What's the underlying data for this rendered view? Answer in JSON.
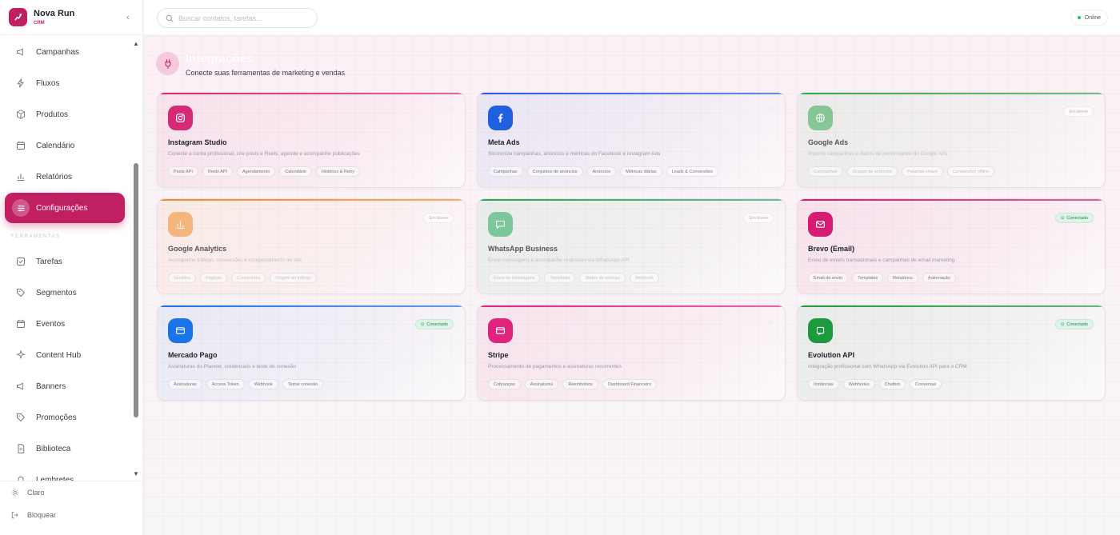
{
  "brand": {
    "name": "Nova Run",
    "sub": "CRM"
  },
  "sidebar": {
    "items": [
      {
        "label": "Campanhas",
        "icon": "megaphone-icon"
      },
      {
        "label": "Fluxos",
        "icon": "zap-icon"
      },
      {
        "label": "Produtos",
        "icon": "box-icon"
      },
      {
        "label": "Calendário",
        "icon": "calendar-icon"
      },
      {
        "label": "Relatórios",
        "icon": "bar-chart-icon"
      },
      {
        "label": "Configurações",
        "icon": "sliders-icon",
        "active": true
      }
    ],
    "section_label": "FERRAMENTAS",
    "tools": [
      {
        "label": "Tarefas",
        "icon": "checkbox-icon"
      },
      {
        "label": "Segmentos",
        "icon": "tag-icon"
      },
      {
        "label": "Eventos",
        "icon": "calendar-icon"
      },
      {
        "label": "Content Hub",
        "icon": "sparkle-icon"
      },
      {
        "label": "Banners",
        "icon": "megaphone-icon"
      },
      {
        "label": "Promoções",
        "icon": "tag-icon"
      },
      {
        "label": "Biblioteca",
        "icon": "file-icon"
      },
      {
        "label": "Lembretes",
        "icon": "bell-icon"
      }
    ],
    "bottom": {
      "theme": "Claro",
      "lock": "Bloquear"
    }
  },
  "topbar": {
    "search_placeholder": "Buscar contatos, tarefas...",
    "status": "Online"
  },
  "page": {
    "title": "Integrações",
    "subtitle": "Conecte suas ferramentas de marketing e vendas"
  },
  "cards": [
    {
      "title": "Instagram Studio",
      "desc": "Conecte a conta profissional, crie posts e Reels, agende e acompanhe publicações",
      "tags": [
        "Posts API",
        "Reels API",
        "Agendamento",
        "Calendário",
        "Histórico & Retry"
      ],
      "color": "#d62976",
      "icon": "instagram-icon",
      "status": "",
      "starred": true
    },
    {
      "title": "Meta Ads",
      "desc": "Sincronize campanhas, anúncios e métricas do Facebook e Instagram Ads",
      "tags": [
        "Campanhas",
        "Conjuntos de anúncios",
        "Anúncios",
        "Métricas diárias",
        "Leads & Conversões"
      ],
      "color": "#1f5fe0",
      "icon": "facebook-icon",
      "status": "",
      "starred": true
    },
    {
      "title": "Google Ads",
      "desc": "Importe campanhas e dados de performance do Google Ads",
      "tags": [
        "Campanhas",
        "Grupos de anúncios",
        "Palavras-chave",
        "Conversões offline"
      ],
      "color": "#34a853",
      "icon": "globe-icon",
      "status": "Em breve",
      "starred": false
    },
    {
      "title": "Google Analytics",
      "desc": "Acompanhe tráfego, conversões e comportamento no site",
      "tags": [
        "Sessões",
        "Páginas",
        "Conversões",
        "Origem do tráfego"
      ],
      "color": "#f28c28",
      "icon": "bar-chart-icon",
      "status": "Em breve",
      "starred": false
    },
    {
      "title": "WhatsApp Business",
      "desc": "Envie mensagens e acompanhe respostas via WhatsApp API",
      "tags": [
        "Envio de mensagens",
        "Templates",
        "Status de entrega",
        "Webhook"
      ],
      "color": "#22a85a",
      "icon": "chat-icon",
      "status": "Em breve",
      "starred": false
    },
    {
      "title": "Brevo (Email)",
      "desc": "Envio de emails transacionais e campanhas de email marketing",
      "tags": [
        "Email de envio",
        "Templates",
        "Relatórios",
        "Automação"
      ],
      "color": "#d81b72",
      "icon": "mail-icon",
      "status": "Conectado",
      "starred": false
    },
    {
      "title": "Mercado Pago",
      "desc": "Assinaturas do Planner, credenciais e teste de conexão",
      "tags": [
        "Assinaturas",
        "Access Token",
        "Webhook",
        "Testar conexão"
      ],
      "color": "#1a73e8",
      "icon": "card-icon",
      "status": "Conectado",
      "starred": false
    },
    {
      "title": "Stripe",
      "desc": "Processamento de pagamentos e assinaturas recorrentes",
      "tags": [
        "Cobranças",
        "Assinaturas",
        "Reembolsos",
        "Dashboard Financeiro"
      ],
      "color": "#e0247e",
      "icon": "card-icon",
      "status": "",
      "starred": true
    },
    {
      "title": "Evolution API",
      "desc": "Integração profissional com WhatsApp via Evolution API para o CRM",
      "tags": [
        "Instâncias",
        "Webhooks",
        "Chatbot",
        "Conversas"
      ],
      "color": "#1e9a3e",
      "icon": "chat-square-icon",
      "status": "Conectado",
      "starred": false
    }
  ],
  "colors": {
    "accent": "#c01f62",
    "connected": "#1e8a4e"
  }
}
